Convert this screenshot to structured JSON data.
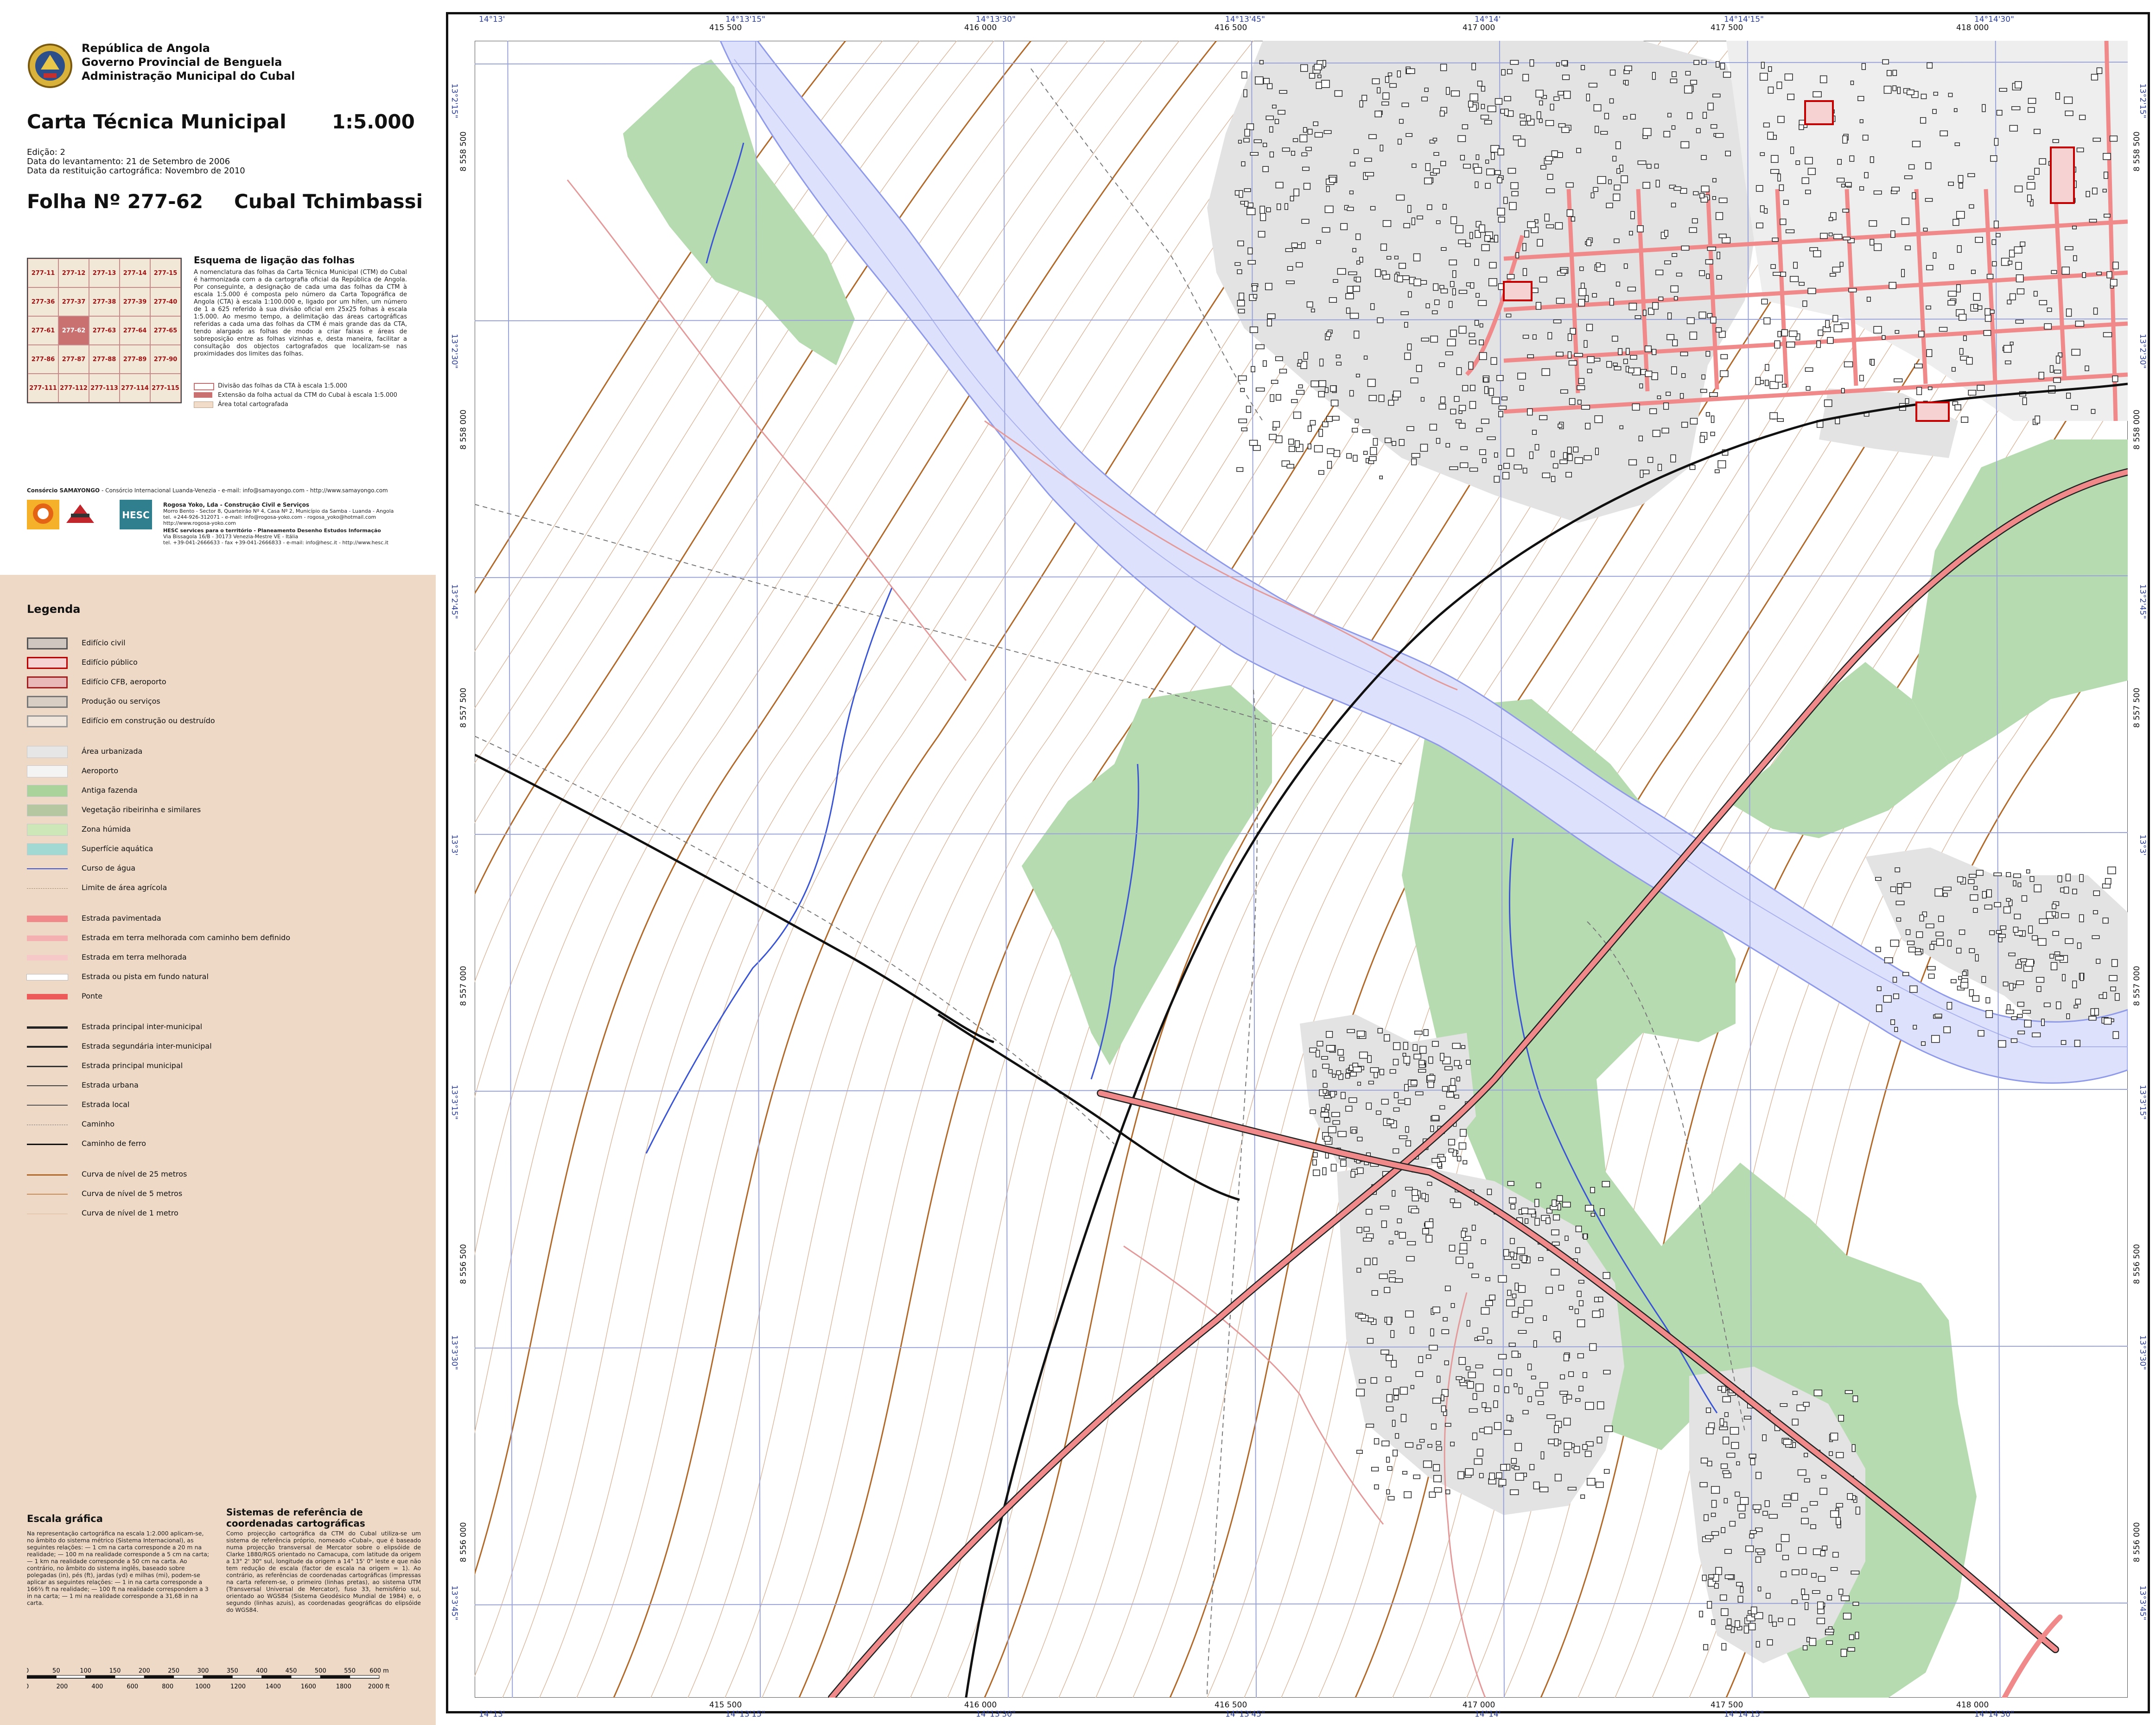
{
  "header": {
    "gov_lines": [
      "República de Angola",
      "Governo Provincial de Benguela",
      "Administração Municipal do Cubal"
    ],
    "title": "Carta Técnica Municipal",
    "scale": "1:5.000",
    "edition": "Edição: 2",
    "survey_date": "Data do levantamento: 21 de Setembro de 2006",
    "restitution_date": "Data da restituição cartográfica: Novembro de 2010",
    "sheet_label": "Folha Nº  277-62",
    "place": "Cubal Tchimbassi"
  },
  "sheet_scheme": {
    "title": "Esquema de ligação das folhas",
    "text": "A nomenclatura das folhas da Carta Técnica Municipal (CTM) do Cubal é harmonizada com a da cartografia oficial da República de Angola. Por conseguinte, a designação de cada uma das folhas da CTM à escala 1:5.000 é composta pelo número da Carta Topográfica de Angola (CTA) à escala 1:100.000 e, ligado por um hífen, um número de 1 a 625 referido à sua divisão oficial em 25x25 folhas à escala 1:5.000. Ao mesmo tempo, a delimitação das áreas cartográficas referidas a cada uma das folhas da CTM é mais grande das da CTA, tendo alargado as folhas de modo a criar faixas e áreas de sobreposição entre as folhas vizinhas e, desta maneira, facilitar a consultação dos objectos cartografados que localizam-se nas proximidades dos limites das folhas.",
    "legend": [
      "Divisão das folhas da CTA à escala 1:5.000",
      "Extensão da folha actual da CTM do Cubal à escala 1:5.000",
      "Área total cartografada"
    ],
    "cells": [
      "277-11",
      "277-12",
      "277-13",
      "277-14",
      "277-15",
      "277-36",
      "277-37",
      "277-38",
      "277-39",
      "277-40",
      "277-61",
      "277-62",
      "277-63",
      "277-64",
      "277-65",
      "277-86",
      "277-87",
      "277-88",
      "277-89",
      "277-90",
      "277-111",
      "277-112",
      "277-113",
      "277-114",
      "277-115"
    ]
  },
  "credits": {
    "consortium": "Consórcio SAMAYONGO",
    "consortium_tail": " - Consórcio Internacional Luanda-Venezia - e-mail: info@samayongo.com - http://www.samayongo.com",
    "rogosa": "Rogosa Yoko, Lda - Construção Civil e Serviços",
    "rogosa_addr": "Morro Bento - Sector 8, Quarteirão Nº 4, Casa Nº 2, Município da Samba - Luanda - Angola",
    "rogosa_contact": "tel. +244-926-312071 - e-mail: info@rogosa-yoko.com - rogosa_yoko@hotmail.com",
    "rogosa_web": "http://www.rogosa-yoko.com",
    "hesc": "HESC services para o território - Planeamento Desenho Estudos Informação",
    "hesc_addr": "Via Bissagola 16/B - 30173 Venezia-Mestre VE - Itália",
    "hesc_contact": "tel. +39-041-2666633 - fax +39-041-2666833 - e-mail: info@hesc.it - http://www.hesc.it",
    "logos": [
      "SAMAYONGO",
      "ROGOSA YOKO",
      "HESC"
    ]
  },
  "legend": {
    "title": "Legenda",
    "items": [
      {
        "label": "Edifício civil",
        "kind": "box",
        "fill": "#d0c6c0",
        "stroke": "#555"
      },
      {
        "label": "Edifício público",
        "kind": "box",
        "fill": "#f6d2d2",
        "stroke": "#c00000"
      },
      {
        "label": "Edifício CFB, aeroporto",
        "kind": "box",
        "fill": "#e9b9b9",
        "stroke": "#a32020"
      },
      {
        "label": "Produção ou serviços",
        "kind": "box",
        "fill": "#d8cec4",
        "stroke": "#777"
      },
      {
        "label": "Edifício em construção ou destruído",
        "kind": "box",
        "fill": "#f1e6dc",
        "stroke": "#999"
      },
      {
        "label": "Área urbanizada",
        "kind": "fill",
        "fill": "#e6e6e6"
      },
      {
        "label": "Aeroporto",
        "kind": "fill",
        "fill": "#f4f4f4"
      },
      {
        "label": "Antiga fazenda",
        "kind": "fill",
        "fill": "#a9d39a"
      },
      {
        "label": "Vegetação ribeirinha e similares",
        "kind": "fill",
        "fill": "#b4c7a0"
      },
      {
        "label": "Zona húmida",
        "kind": "fill",
        "fill": "#cde7b9"
      },
      {
        "label": "Superfície aquática",
        "kind": "fill",
        "fill": "#a3d9d3"
      },
      {
        "label": "Curso de água",
        "kind": "line",
        "stroke": "#3b55d0",
        "w": 2
      },
      {
        "label": "Limite de área agrícola",
        "kind": "line",
        "stroke": "#9a8a6a",
        "w": 1,
        "dash": true
      },
      {
        "label": "Estrada pavimentada",
        "kind": "line",
        "stroke": "#f08a8a",
        "w": 14
      },
      {
        "label": "Estrada em terra melhorada com caminho bem definido",
        "kind": "line",
        "stroke": "#f4b0b0",
        "w": 12
      },
      {
        "label": "Estrada em terra melhorada",
        "kind": "line",
        "stroke": "#f6c8c8",
        "w": 12
      },
      {
        "label": "Estrada ou pista em fundo natural",
        "kind": "line",
        "stroke": "#ffffff",
        "w": 12
      },
      {
        "label": "Ponte",
        "kind": "line",
        "stroke": "#ec5a5a",
        "w": 12
      },
      {
        "label": "Estrada principal inter-municipal",
        "kind": "line",
        "stroke": "#222",
        "w": 5
      },
      {
        "label": "Estrada segundária inter-municipal",
        "kind": "line",
        "stroke": "#222",
        "w": 4
      },
      {
        "label": "Estrada principal municipal",
        "kind": "line",
        "stroke": "#333",
        "w": 3
      },
      {
        "label": "Estrada urbana",
        "kind": "line",
        "stroke": "#444",
        "w": 2
      },
      {
        "label": "Estrada local",
        "kind": "line",
        "stroke": "#555",
        "w": 2
      },
      {
        "label": "Caminho",
        "kind": "line",
        "stroke": "#777",
        "w": 1,
        "dash": true
      },
      {
        "label": "Caminho de ferro",
        "kind": "line",
        "stroke": "#111",
        "w": 3
      },
      {
        "label": "Curva de nível de 25 metros",
        "kind": "line",
        "stroke": "#b06a2c",
        "w": 3
      },
      {
        "label": "Curva de nível de 5 metros",
        "kind": "line",
        "stroke": "#c88c5a",
        "w": 2
      },
      {
        "label": "Curva de nível de 1 metro",
        "kind": "line",
        "stroke": "#ddb89a",
        "w": 1
      }
    ]
  },
  "scale_section": {
    "title": "Escala gráfica",
    "text": "Na representação cartográfica na escala 1:2.000 aplicam-se, no âmbito do sistema métrico (Sistema Internacional), as seguintes relações: — 1 cm na carta corresponde a 20 m na realidade; — 100 m na realidade corresponde a 5 cm na carta; — 1 km na realidade corresponde a 50 cm na carta. Ao contrário, no âmbito do sistema inglês, baseado sobre polegadas (in), pés (ft), jardas (yd) e milhas (mi), podem-se aplicar as seguintes relações: — 1 in na carta corresponde a 166⅔ ft na realidade; — 100 ft na realidade correspondem a 3 in na carta; — 1 mi na realidade corresponde a 31,68 in na carta.",
    "metres_ticks": [
      "0",
      "50",
      "100",
      "150",
      "200",
      "250",
      "300",
      "350",
      "400",
      "450",
      "500",
      "550",
      "600 m"
    ],
    "feet_ticks": [
      "0",
      "200",
      "400",
      "600",
      "800",
      "1000",
      "1200",
      "1400",
      "1600",
      "1800",
      "2000 ft"
    ]
  },
  "crs_section": {
    "title": "Sistemas de referência de coordenadas cartográficas",
    "text": "Como projecção cartográfica da CTM do Cubal utiliza-se um sistema de referência próprio, nomeado «Cubal», que é baseado numa projecção transversal de Mercator sobre o elipsóide de Clarke 1880/RGS orientado no Camacupa, com latitude da origem a 13° 2' 30\" sul, longitude da origem a 14° 15' 0\" leste e que não tem redução de escala (factor de escala na origem = 1). Ao contrário, as referências de coordenadas cartográficas (impressas na carta referem-se, o primeiro (linhas pretas), ao sistema UTM (Transversal Universal de Mercator), fuso 33, hemisfério sul, orientado ao WGS84 (Sistema Geodésico Mundial de 1984) e, o segundo (linhas azuis), as coordenadas geográficas do elipsóide do WGS84."
  },
  "map": {
    "easting_labels": [
      "415 500",
      "416 000",
      "416 500",
      "417 000",
      "417 500",
      "418 000"
    ],
    "longitude_labels": [
      "14°13'",
      "14°13'15\"",
      "14°13'30\"",
      "14°13'45\"",
      "14°14'",
      "14°14'15\"",
      "14°14'30\""
    ],
    "northing_labels": [
      "8 558 500",
      "8 558 000",
      "8 557 500",
      "8 557 000",
      "8 556 500",
      "8 556 000"
    ],
    "latitude_labels": [
      "13°2'15\"",
      "13°2'30\"",
      "13°2'45\"",
      "13°3'",
      "13°3'15\"",
      "13°3'30\"",
      "13°3'45\""
    ],
    "colors": {
      "urban": "#e6e6e6",
      "farm": "#b7dbb0",
      "water": "#dde1fb",
      "river_line": "#8f9be8",
      "stream": "#3b55d0",
      "road": "#f08a8a",
      "contour_major": "#b06a2c",
      "contour_minor": "#d9b9a0",
      "grid_blue": "#9aa3d8",
      "rail": "#111111"
    }
  }
}
